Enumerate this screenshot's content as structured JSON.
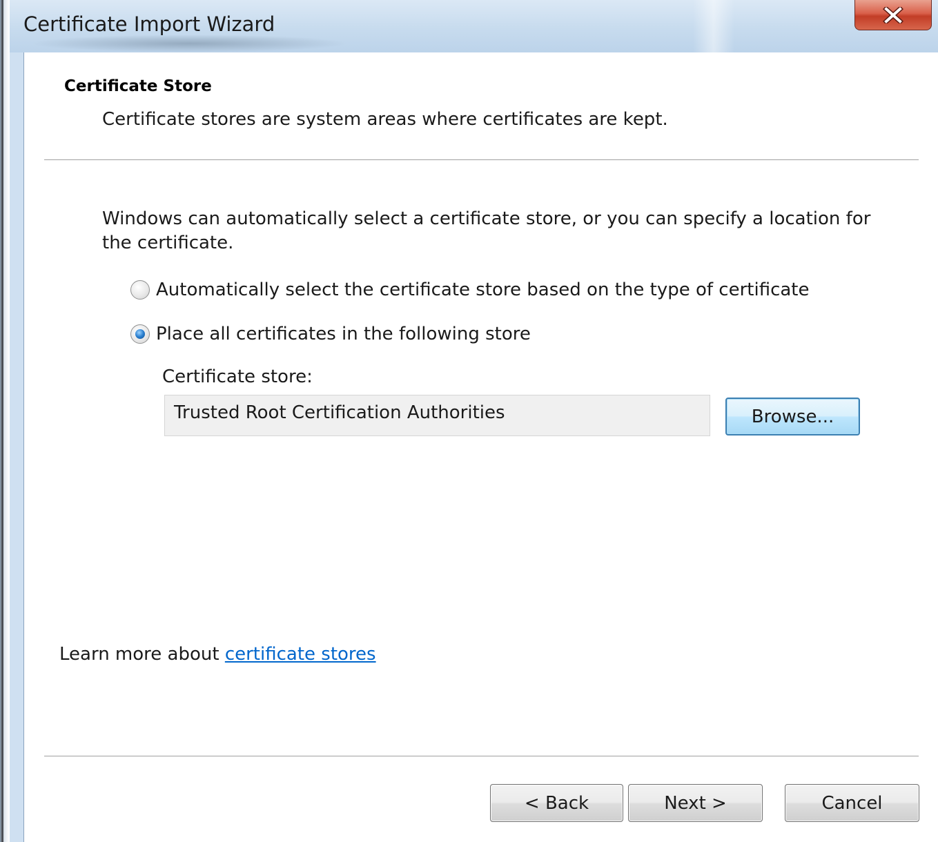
{
  "window": {
    "title": "Certificate Import Wizard",
    "close_icon": "close-icon"
  },
  "header": {
    "title": "Certificate Store",
    "subtitle": "Certificate stores are system areas where certificates are kept."
  },
  "body": {
    "description": "Windows can automatically select a certificate store, or you can specify a location for the certificate.",
    "options": [
      {
        "label": "Automatically select the certificate store based on the type of certificate",
        "selected": false
      },
      {
        "label": "Place all certificates in the following store",
        "selected": true
      }
    ],
    "store_label": "Certificate store:",
    "store_value": "Trusted Root Certification Authorities",
    "browse_label": "Browse..."
  },
  "learn_more": {
    "prefix": "Learn more about ",
    "link": "certificate stores"
  },
  "footer": {
    "back_label": "< Back",
    "next_label": "Next >",
    "cancel_label": "Cancel"
  },
  "colors": {
    "link": "#0066cc",
    "close_button": "#c23d26",
    "radio_selected": "#2a7fcf"
  }
}
